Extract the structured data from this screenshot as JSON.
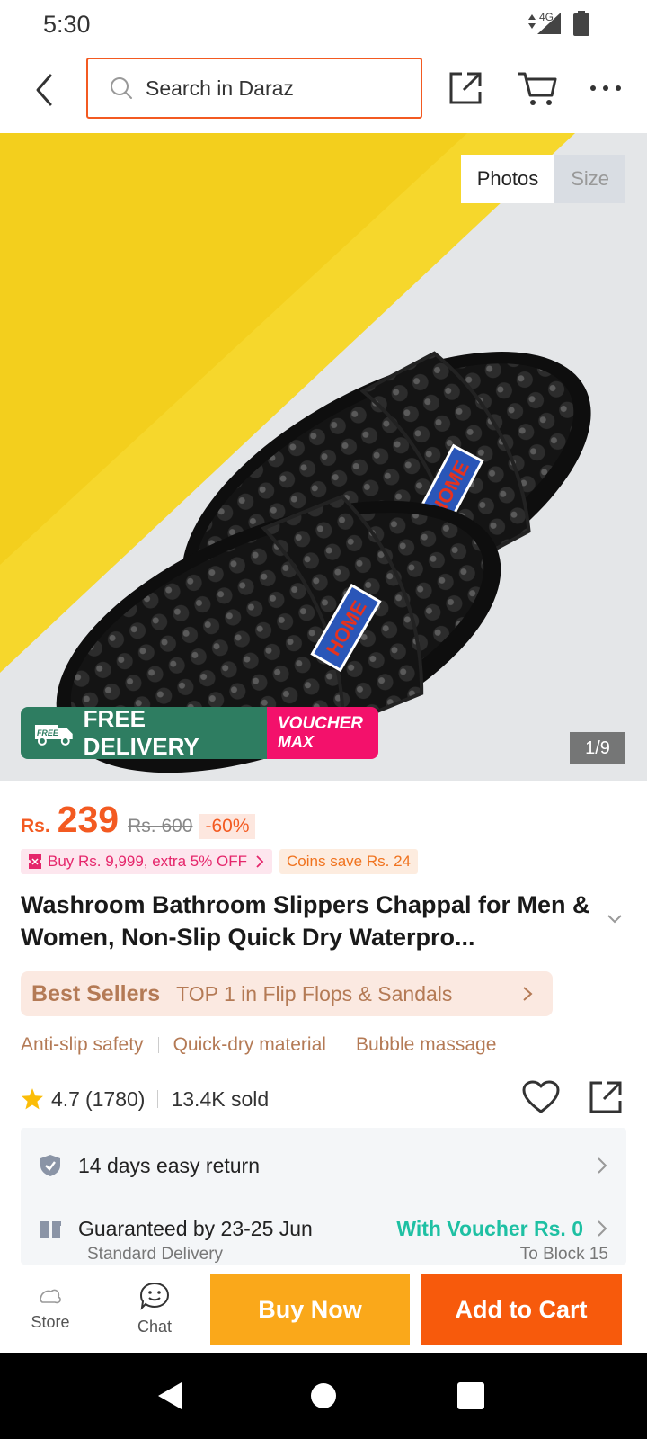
{
  "status_bar": {
    "time": "5:30",
    "network": "4G"
  },
  "search": {
    "placeholder": "Search in Daraz"
  },
  "gallery": {
    "tabs": [
      "Photos",
      "Size"
    ],
    "counter": "1/9",
    "badge_text": "HOME",
    "promo": {
      "free_badge": "FREE",
      "free_label": "FREE DELIVERY",
      "voucher_line1": "VOUCHER",
      "voucher_line2": "MAX"
    }
  },
  "price": {
    "currency": "Rs.",
    "current": "239",
    "original": "Rs. 600",
    "discount": "-60%"
  },
  "chips": {
    "buy_offer": "Buy Rs. 9,999, extra 5% OFF",
    "coins": "Coins save Rs. 24"
  },
  "product": {
    "title": "Washroom Bathroom Slippers Chappal for Men & Women, Non-Slip Quick Dry Waterpro..."
  },
  "best_sellers": {
    "label": "Best Sellers",
    "rank": "TOP 1 in Flip Flops & Sandals"
  },
  "features": [
    "Anti-slip safety",
    "Quick-dry material",
    "Bubble massage"
  ],
  "rating": {
    "score": "4.7",
    "count": "(1780)",
    "sold": "13.4K sold"
  },
  "services": {
    "return": "14 days easy return",
    "delivery": "Guaranteed by 23-25 Jun",
    "voucher": "With Voucher Rs. 0",
    "delivery_type": "Standard Delivery",
    "location": "To Block 15"
  },
  "bottom_bar": {
    "store": "Store",
    "chat": "Chat",
    "buy_now": "Buy Now",
    "add_to_cart": "Add to Cart"
  },
  "colors": {
    "accent": "#f35a21",
    "buy_now": "#faa81a",
    "add_to_cart": "#f75a0c",
    "voucher": "#1ec0a3",
    "bestseller": "#b47a55",
    "free_delivery": "#2e7d61",
    "voucher_max": "#f3116b"
  }
}
